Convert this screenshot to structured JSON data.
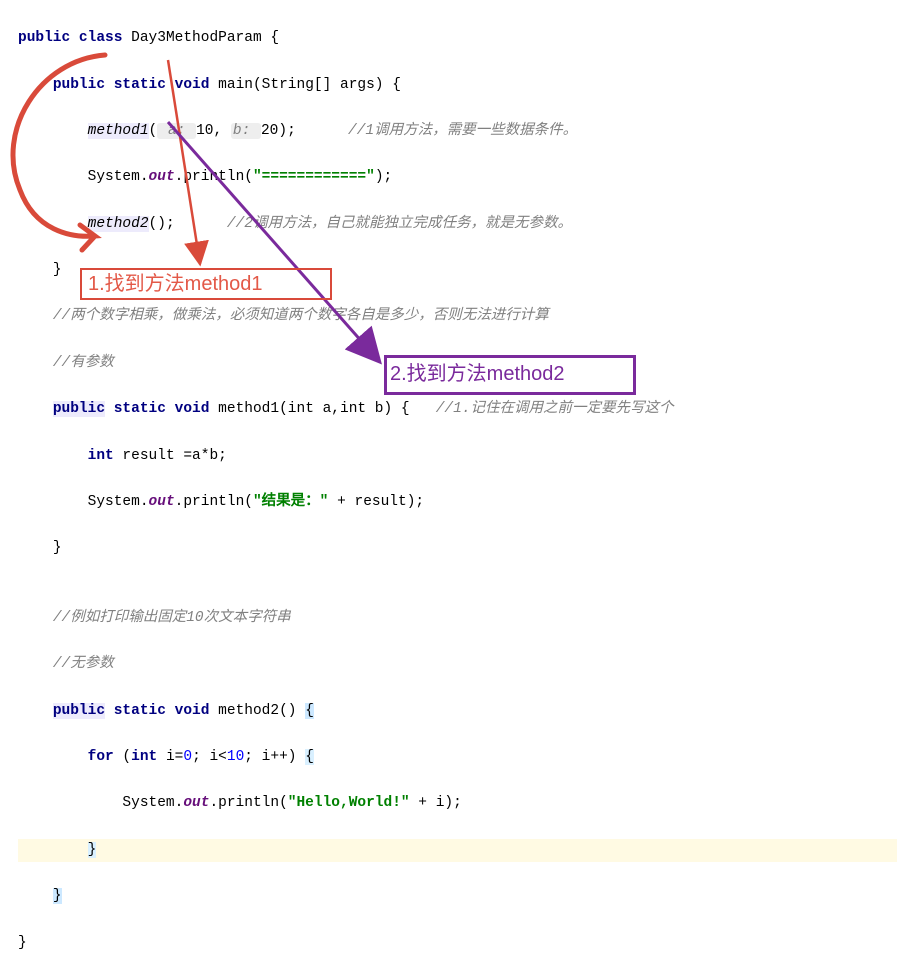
{
  "line1": {
    "kw_public": "public",
    "kw_class": "class",
    "name": "Day3MethodParam",
    "brace": "{"
  },
  "line2": {
    "kw_public": "public",
    "kw_static": "static",
    "kw_void": "void",
    "name": "main",
    "args": "(String[] args) {"
  },
  "line3": {
    "call": "method1",
    "open": "(",
    "hint_a": " a: ",
    "val_a": "10",
    "comma": ", ",
    "hint_b": "b: ",
    "val_b": "20",
    "close": ");",
    "comment": "//1调用方法，需要一些数据条件。"
  },
  "line4": {
    "pre": "System.",
    "out": "out",
    "mid": ".println(",
    "str": "\"============\"",
    "end": ");"
  },
  "line5": {
    "call": "method2",
    "rest": "();",
    "comment": "//2调用方法，自己就能独立完成任务，就是无参数。"
  },
  "line6": {
    "brace": "}"
  },
  "line7": {
    "comment": "//两个数字相乘，做乘法，必须知道两个数字各自是多少，否则无法进行计算"
  },
  "line8": {
    "comment": "//有参数"
  },
  "line9": {
    "kw_public": "public",
    "kw_static": "static",
    "kw_void": "void",
    "name": "method1",
    "params": "(int a,int b) {",
    "comment": "//1.记住在调用之前一定要先写这个"
  },
  "line10": {
    "kw_int": "int",
    "rest": " result =a*b;"
  },
  "line11": {
    "pre": "System.",
    "out": "out",
    "mid": ".println(",
    "str": "\"结果是：\"",
    "plus": " + result);"
  },
  "line12": {
    "brace": "}"
  },
  "blank": "",
  "line13": {
    "comment": "//例如打印输出固定10次文本字符串"
  },
  "line14": {
    "comment": "//无参数"
  },
  "line15": {
    "kw_public": "public",
    "kw_static": "static",
    "kw_void": "void",
    "name": "method2",
    "params": "() ",
    "brace": "{"
  },
  "line16": {
    "kw_for": "for",
    "open": " (",
    "kw_int": "int",
    "rest1": " i=",
    "zero": "0",
    "rest2": "; i<",
    "ten": "10",
    "rest3": "; i++) ",
    "brace": "{"
  },
  "line17": {
    "pre": "System.",
    "out": "out",
    "mid": ".println(",
    "str": "\"Hello,World!\"",
    "plus": " + i);"
  },
  "line18": {
    "brace": "}"
  },
  "line19": {
    "brace": "}"
  },
  "line20": {
    "brace": "}"
  },
  "annot1": "1.找到方法method1",
  "annot2": "2.找到方法method2"
}
